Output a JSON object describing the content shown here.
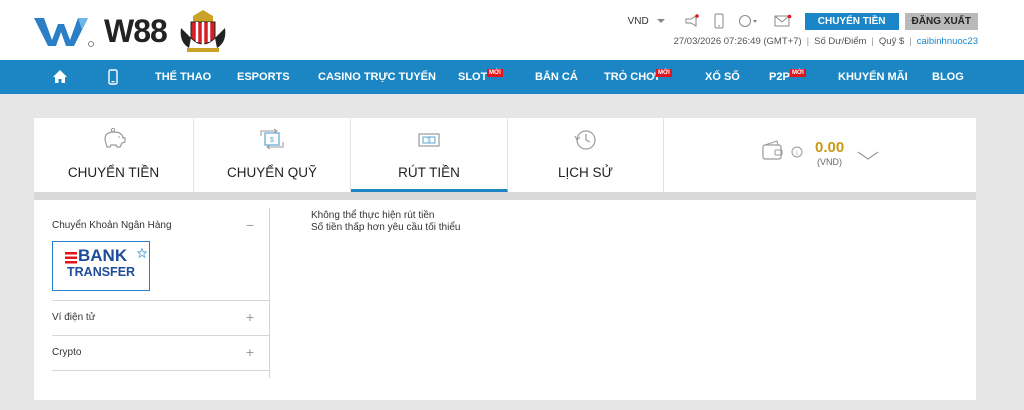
{
  "brand": {
    "name": "W88"
  },
  "header": {
    "currency": "VND",
    "transfer_button": "CHUYỂN TIỀN",
    "logout_button": "ĐĂNG XUẤT",
    "datetime": "27/03/2026 07:26:49 (GMT+7)",
    "balance_label": "Số Dư/Điểm",
    "fund_label": "Quỹ $",
    "username": "caibinhnuoc23"
  },
  "nav": {
    "items": [
      {
        "label": "THỂ THAO"
      },
      {
        "label": "ESPORTS"
      },
      {
        "label": "CASINO TRỰC TUYẾN"
      },
      {
        "label": "SLOT",
        "badge": "MỚI"
      },
      {
        "label": "BẮN CÁ"
      },
      {
        "label": "TRÒ CHƠI",
        "badge": "MỚI"
      },
      {
        "label": "XỔ SỐ"
      },
      {
        "label": "P2P",
        "badge": "MỚI"
      },
      {
        "label": "KHUYẾN MÃI"
      },
      {
        "label": "BLOG"
      }
    ]
  },
  "tabs": [
    {
      "label": "CHUYỂN TIỀN",
      "icon": "piggy-bank-icon"
    },
    {
      "label": "CHUYỂN QUỸ",
      "icon": "transfer-icon"
    },
    {
      "label": "RÚT TIỀN",
      "icon": "withdraw-icon",
      "active": true
    },
    {
      "label": "LỊCH SỬ",
      "icon": "history-icon"
    }
  ],
  "wallet": {
    "amount": "0.00",
    "currency": "(VND)"
  },
  "sidebar": {
    "bank_transfer": {
      "label": "Chuyển Khoản Ngân Hàng",
      "logo_line1": "BANK",
      "logo_line2": "TRANSFER",
      "control": "−"
    },
    "ewallet": {
      "label": "Ví điện tử",
      "control": "+"
    },
    "crypto": {
      "label": "Crypto",
      "control": "+"
    }
  },
  "message": {
    "line1": "Không thể thực hiện rút tiền",
    "line2": "Số tiền thấp hơn yêu cầu tối thiểu"
  },
  "colors": {
    "brand_blue": "#1b86c3",
    "accent_gold": "#c99a14",
    "badge_red": "#e3141b"
  }
}
